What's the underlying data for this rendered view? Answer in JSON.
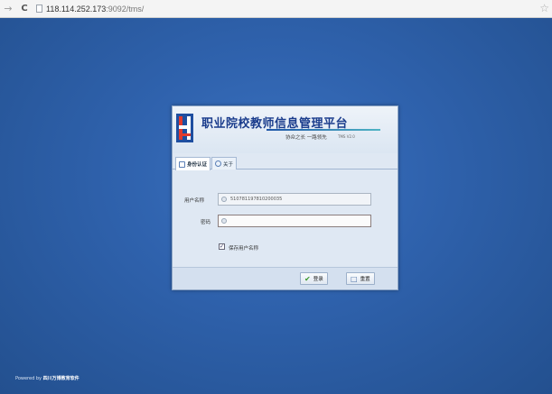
{
  "browser": {
    "back_icon": "back-arrow-icon",
    "reload_icon": "reload-icon",
    "url_host": "118.114.252.173",
    "url_path": ":9092/tms/",
    "star_icon": "star-icon"
  },
  "login": {
    "title": "职业院校教师信息管理平台",
    "motto": "协众之长  一路领先",
    "version": "TMS V2.0",
    "tabs": [
      {
        "label": "身份认证",
        "active": true
      },
      {
        "label": "关于",
        "active": false
      }
    ],
    "username_label": "用户名称",
    "username_value": "510781197810200035",
    "password_label": "密码",
    "password_value": "",
    "remember_label": "保存用户名称",
    "remember_checked": true,
    "login_button": "登录",
    "reset_button": "重置"
  },
  "footer": {
    "prefix": "Powered by ",
    "company": "四川万博教育软件"
  },
  "colors": {
    "background": "#2f62ad",
    "title": "#1a3c8c",
    "dialog": "#dfe8f3"
  }
}
